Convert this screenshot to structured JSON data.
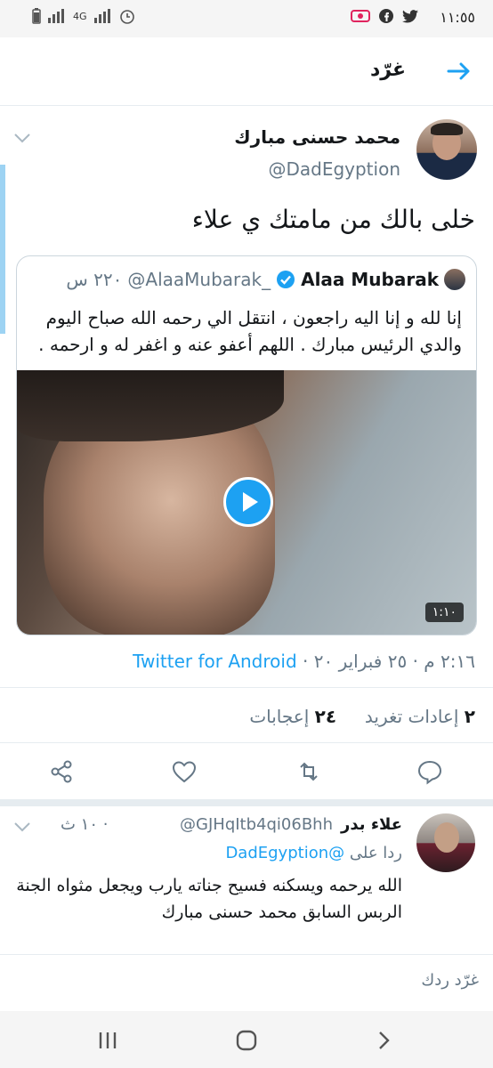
{
  "status_bar": {
    "time": "١١:٥٥",
    "network": "4G"
  },
  "header": {
    "title": "غرّد"
  },
  "tweet": {
    "author_name": "محمد حسنى مبارك",
    "author_handle": "@DadEgyption",
    "text": "خلى بالك من مامتك ي علاء",
    "quoted": {
      "author_name": "Alaa Mubarak",
      "author_handle": "@AlaaMubarak_",
      "time": "٢٢٠ س",
      "text": "إنا لله و إنا اليه راجعون ، انتقل الي رحمه الله صباح اليوم والدي الرئيس مبارك . اللهم أعفو عنه و اغفر له و ارحمه .",
      "video_duration": "١:١٠"
    },
    "timestamp": "٢:١٦ م · ٢٥ فبراير ٢٠ ·",
    "source": "Twitter for Android",
    "retweets_count": "٢",
    "retweets_label": "إعادات تغريد",
    "likes_count": "٢٤",
    "likes_label": "إعجابات"
  },
  "reply": {
    "author_name": "علاء بدر",
    "author_handle": "@GJHqItb4qi06Bhh",
    "time": "١٠ ث ·",
    "replying_prefix": "ردا على",
    "replying_to": "@DadEgyption",
    "text": "الله يرحمه ويسكنه فسيح جناته يارب ويجعل مثواه الجنة الربس السابق محمد حسنى مبارك"
  },
  "compose": {
    "placeholder": "غرّد ردك"
  },
  "colors": {
    "accent": "#1da1f2",
    "secondary_text": "#657786",
    "border": "#e6ecf0"
  }
}
